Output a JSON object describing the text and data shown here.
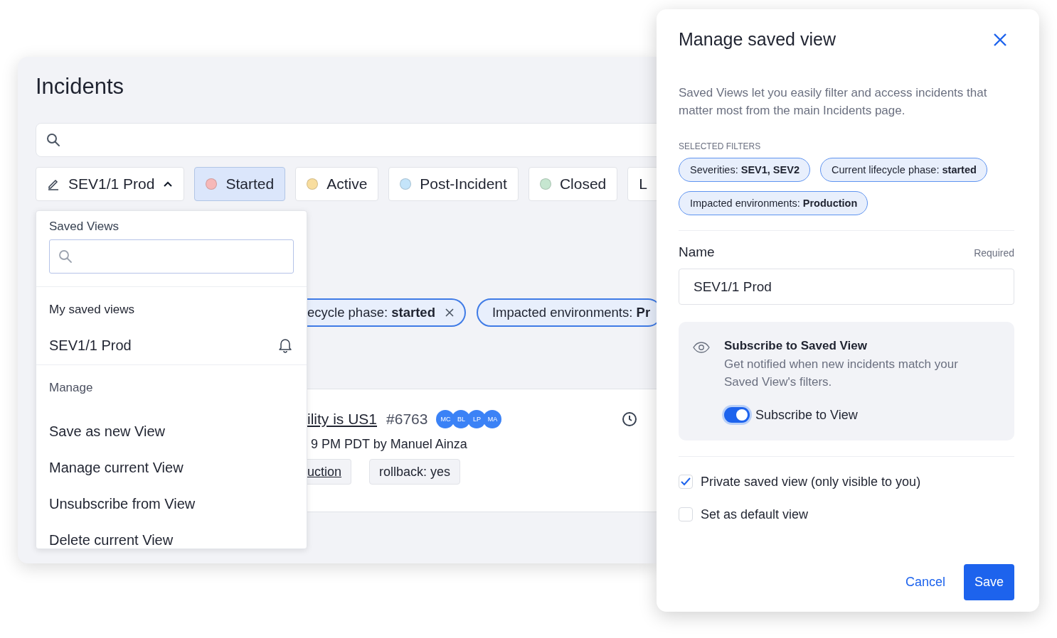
{
  "incidents_page": {
    "title": "Incidents",
    "saved_view_button": {
      "label": "SEV1/1 Prod",
      "expanded": true
    },
    "status_filters": [
      {
        "label": "Started",
        "selected": true,
        "color": "#f6b8b8"
      },
      {
        "label": "Active",
        "selected": false,
        "color": "#f8dd9e"
      },
      {
        "label": "Post-Incident",
        "selected": false,
        "color": "#c4e4fa"
      },
      {
        "label": "Closed",
        "selected": false,
        "color": "#c6e6d0"
      },
      {
        "label": "L",
        "selected": false
      }
    ],
    "active_filter_chips": [
      {
        "label": "ecycle phase: **started**",
        "removable": true
      },
      {
        "label": "Impacted environments: **Pr**",
        "removable": false
      }
    ],
    "incident": {
      "title": "ility is US1",
      "number": "#6763",
      "assignees": [
        "MC",
        "BL",
        "LP",
        "MA"
      ],
      "meta": "9 PM PDT by Manuel Ainza",
      "tags": [
        {
          "label": "uction",
          "kind": "link"
        },
        {
          "label": "rollback: yes",
          "kind": "plain"
        }
      ]
    }
  },
  "saved_views_menu": {
    "heading": "Saved Views",
    "my_views_heading": "My saved views",
    "my_views": [
      {
        "label": "SEV1/1 Prod",
        "subscribed": true
      }
    ],
    "manage_heading": "Manage",
    "manage_actions": [
      "Save as new View",
      "Manage current View",
      "Unsubscribe from View",
      "Delete current View"
    ]
  },
  "modal": {
    "title": "Manage saved view",
    "description": "Saved Views let you easily filter and access incidents that matter most from the main Incidents page.",
    "selected_filters_label": "SELECTED FILTERS",
    "selected_filters": [
      "Severities: **SEV1, SEV2**",
      "Current lifecycle phase: **started**",
      "Impacted environments: **Production**"
    ],
    "name_label": "Name",
    "name_hint": "Required",
    "name_value": "SEV1/1 Prod",
    "subscribe": {
      "title": "Subscribe to Saved View",
      "description": "Get notified when new incidents match your Saved View's filters.",
      "toggle_label": "Subscribe to View",
      "on": true
    },
    "options": [
      {
        "label": "Private saved view (only visible to you)",
        "checked": true
      },
      {
        "label": "Set as default view",
        "checked": false
      }
    ],
    "cancel": "Cancel",
    "save": "Save"
  }
}
